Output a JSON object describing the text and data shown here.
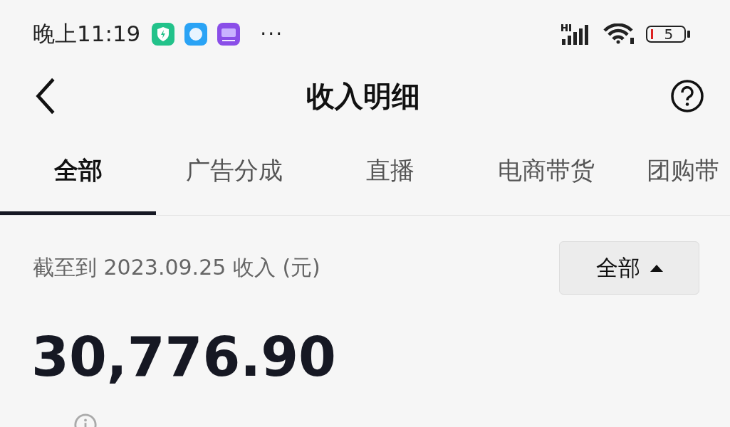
{
  "status_bar": {
    "time": "晚上11:19",
    "more": "···",
    "battery": "5"
  },
  "header": {
    "title": "收入明细"
  },
  "tabs": [
    {
      "label": "全部",
      "selected": true
    },
    {
      "label": "广告分成",
      "selected": false
    },
    {
      "label": "直播",
      "selected": false
    },
    {
      "label": "电商带货",
      "selected": false
    },
    {
      "label": "团购带",
      "selected": false
    }
  ],
  "summary": {
    "caption": "截至到 2023.09.25 收入 (元)",
    "filter": "全部",
    "amount": "30,776.90"
  }
}
